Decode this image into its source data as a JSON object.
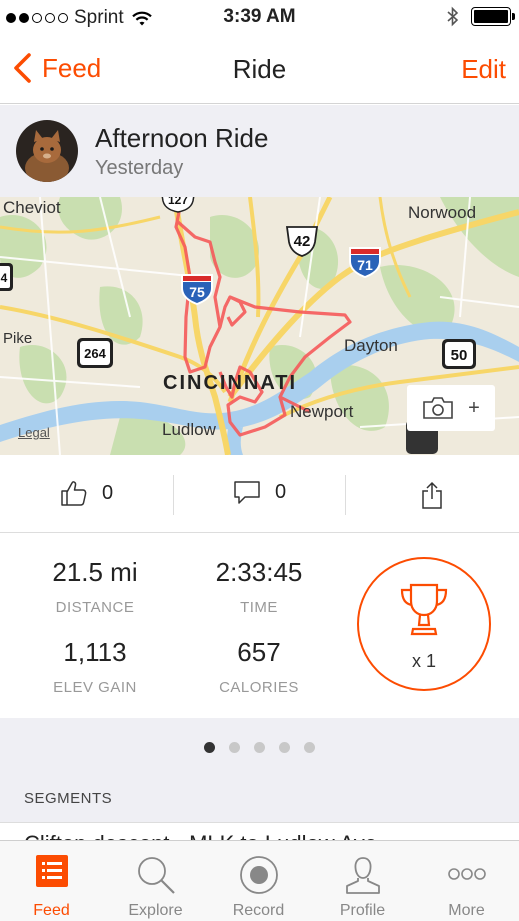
{
  "status_bar": {
    "carrier": "Sprint",
    "time": "3:39 AM"
  },
  "nav": {
    "back_label": "Feed",
    "title": "Ride",
    "edit_label": "Edit"
  },
  "activity": {
    "name": "Afternoon Ride",
    "date": "Yesterday"
  },
  "map": {
    "labels": {
      "cheviot": "Cheviot",
      "norwood": "Norwood",
      "pike": "Pike",
      "cincinnati": "CINCINNATI",
      "dayton": "Dayton",
      "newport": "Newport",
      "ludlow": "Ludlow",
      "legal": "Legal"
    },
    "shields": {
      "i75": "75",
      "i71": "71",
      "us42": "42",
      "oh264": "264",
      "us50": "50",
      "us127": "127",
      "edge4": "4"
    },
    "route_color": "#f55a5a"
  },
  "social": {
    "kudos_count": "0",
    "comment_count": "0"
  },
  "stats": {
    "distance_value": "21.5 mi",
    "distance_label": "DISTANCE",
    "time_value": "2:33:45",
    "time_label": "TIME",
    "elev_value": "1,113",
    "elev_label": "ELEV GAIN",
    "calories_value": "657",
    "calories_label": "CALORIES",
    "trophy_count": "x 1"
  },
  "pager": {
    "total": 5,
    "active_index": 0
  },
  "segments": {
    "header": "SEGMENTS",
    "first_segment_peek": "Clifton descent - MLK to Ludlow Ave"
  },
  "tabs": [
    {
      "label": "Feed",
      "icon": "feed-icon",
      "active": true
    },
    {
      "label": "Explore",
      "icon": "explore-icon",
      "active": false
    },
    {
      "label": "Record",
      "icon": "record-icon",
      "active": false
    },
    {
      "label": "Profile",
      "icon": "profile-icon",
      "active": false
    },
    {
      "label": "More",
      "icon": "more-icon",
      "active": false
    }
  ],
  "colors": {
    "accent": "#fc4c02",
    "header_bg": "#efeff4"
  }
}
